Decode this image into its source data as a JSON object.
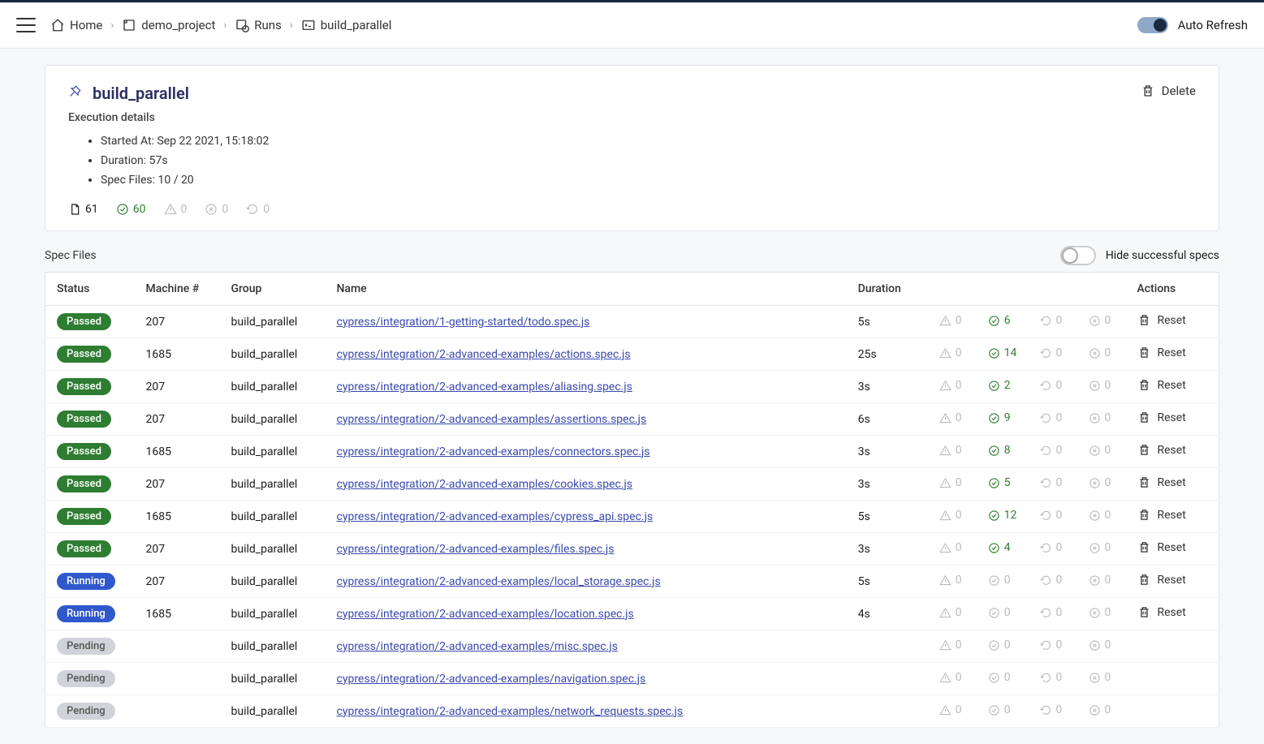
{
  "topbar": {
    "breadcrumb": [
      {
        "label": "Home",
        "icon": "home"
      },
      {
        "label": "demo_project",
        "icon": "project"
      },
      {
        "label": "Runs",
        "icon": "runs"
      },
      {
        "label": "build_parallel",
        "icon": "terminal"
      }
    ],
    "auto_refresh_label": "Auto Refresh"
  },
  "run": {
    "title": "build_parallel",
    "subtitle": "Execution details",
    "delete_label": "Delete",
    "details": {
      "started_at_label": "Started At:",
      "started_at_value": "Sep 22 2021, 15:18:02",
      "duration_label": "Duration:",
      "duration_value": "57s",
      "spec_files_label": "Spec Files:",
      "spec_files_value": "10 / 20"
    },
    "summary": {
      "total": "61",
      "passed": "60",
      "flaky": "0",
      "failed": "0",
      "retry": "0"
    }
  },
  "specs_section": {
    "title": "Spec Files",
    "hide_label": "Hide successful specs"
  },
  "table": {
    "headers": {
      "status": "Status",
      "machine": "Machine #",
      "group": "Group",
      "name": "Name",
      "duration": "Duration",
      "actions": "Actions"
    },
    "reset_label": "Reset",
    "rows": [
      {
        "status": "Passed",
        "machine": "207",
        "group": "build_parallel",
        "name": "cypress/integration/1-getting-started/todo.spec.js",
        "duration": "5s",
        "flaky": "0",
        "passed": "6",
        "retry": "0",
        "failed": "0",
        "show_reset": true
      },
      {
        "status": "Passed",
        "machine": "1685",
        "group": "build_parallel",
        "name": "cypress/integration/2-advanced-examples/actions.spec.js",
        "duration": "25s",
        "flaky": "0",
        "passed": "14",
        "retry": "0",
        "failed": "0",
        "show_reset": true
      },
      {
        "status": "Passed",
        "machine": "207",
        "group": "build_parallel",
        "name": "cypress/integration/2-advanced-examples/aliasing.spec.js",
        "duration": "3s",
        "flaky": "0",
        "passed": "2",
        "retry": "0",
        "failed": "0",
        "show_reset": true
      },
      {
        "status": "Passed",
        "machine": "207",
        "group": "build_parallel",
        "name": "cypress/integration/2-advanced-examples/assertions.spec.js",
        "duration": "6s",
        "flaky": "0",
        "passed": "9",
        "retry": "0",
        "failed": "0",
        "show_reset": true
      },
      {
        "status": "Passed",
        "machine": "1685",
        "group": "build_parallel",
        "name": "cypress/integration/2-advanced-examples/connectors.spec.js",
        "duration": "3s",
        "flaky": "0",
        "passed": "8",
        "retry": "0",
        "failed": "0",
        "show_reset": true
      },
      {
        "status": "Passed",
        "machine": "207",
        "group": "build_parallel",
        "name": "cypress/integration/2-advanced-examples/cookies.spec.js",
        "duration": "3s",
        "flaky": "0",
        "passed": "5",
        "retry": "0",
        "failed": "0",
        "show_reset": true
      },
      {
        "status": "Passed",
        "machine": "1685",
        "group": "build_parallel",
        "name": "cypress/integration/2-advanced-examples/cypress_api.spec.js",
        "duration": "5s",
        "flaky": "0",
        "passed": "12",
        "retry": "0",
        "failed": "0",
        "show_reset": true
      },
      {
        "status": "Passed",
        "machine": "207",
        "group": "build_parallel",
        "name": "cypress/integration/2-advanced-examples/files.spec.js",
        "duration": "3s",
        "flaky": "0",
        "passed": "4",
        "retry": "0",
        "failed": "0",
        "show_reset": true
      },
      {
        "status": "Running",
        "machine": "207",
        "group": "build_parallel",
        "name": "cypress/integration/2-advanced-examples/local_storage.spec.js",
        "duration": "5s",
        "flaky": "0",
        "passed": "0",
        "retry": "0",
        "failed": "0",
        "show_reset": true
      },
      {
        "status": "Running",
        "machine": "1685",
        "group": "build_parallel",
        "name": "cypress/integration/2-advanced-examples/location.spec.js",
        "duration": "4s",
        "flaky": "0",
        "passed": "0",
        "retry": "0",
        "failed": "0",
        "show_reset": true
      },
      {
        "status": "Pending",
        "machine": "",
        "group": "build_parallel",
        "name": "cypress/integration/2-advanced-examples/misc.spec.js",
        "duration": "",
        "flaky": "0",
        "passed": "0",
        "retry": "0",
        "failed": "0",
        "show_reset": false
      },
      {
        "status": "Pending",
        "machine": "",
        "group": "build_parallel",
        "name": "cypress/integration/2-advanced-examples/navigation.spec.js",
        "duration": "",
        "flaky": "0",
        "passed": "0",
        "retry": "0",
        "failed": "0",
        "show_reset": false
      },
      {
        "status": "Pending",
        "machine": "",
        "group": "build_parallel",
        "name": "cypress/integration/2-advanced-examples/network_requests.spec.js",
        "duration": "",
        "flaky": "0",
        "passed": "0",
        "retry": "0",
        "failed": "0",
        "show_reset": false
      }
    ]
  }
}
